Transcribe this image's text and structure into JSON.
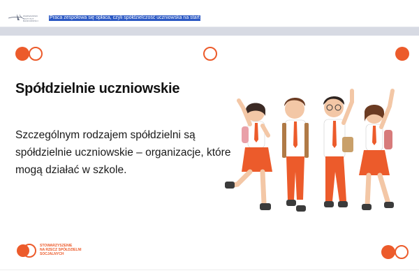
{
  "header": {
    "org_logo_icon": "fountain-pen-icon",
    "org_logo_text": "WARSZAWSKI\nINSTYTUT\nBANKOWOŚCI",
    "document_title": "Praca zespołowa się opłaca, czyli spółdzielczość uczniowska na start"
  },
  "slide": {
    "title": "Spółdzielnie uczniowskie",
    "body": "Szczególnym rodzajem spółdzielni są spółdzielnie uczniowskie – organizacje, które mogą działać w szkole.",
    "illustration_icon": "cheering-students-illustration",
    "footer": {
      "logo_icon": "interlocking-circles-icon",
      "lines": [
        "STOWARZYSZENIE",
        "NA RZECZ SPÓŁDZIELNI",
        "SOCJALNYCH"
      ]
    }
  },
  "colors": {
    "accent": "#ec5b2b",
    "selection": "#2b58c4",
    "skirt": "#ec5b2b"
  }
}
